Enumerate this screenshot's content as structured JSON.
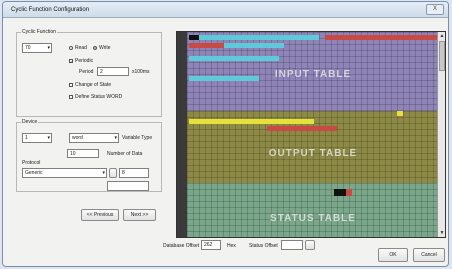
{
  "window": {
    "title": "Cyclic Function Configuration",
    "close_label": "X"
  },
  "cyclic": {
    "group_label": "Cyclic Function",
    "function_value": "70",
    "read_label": "Read",
    "write_label": "Write",
    "periodic_label": "Periodic",
    "period_label": "Period",
    "period_value": "2",
    "period_unit": "x100ms",
    "change_of_state_label": "Change of State",
    "define_status_label": "Define Status WORD"
  },
  "device": {
    "group_label": "Device",
    "device_value": "1",
    "variable_value": "word",
    "variable_type_label": "Variable Type",
    "address_value": "10",
    "number_of_data_label": "Number of Data",
    "protocol_label": "Protocol",
    "protocol_value": "Generic",
    "number_of_data_value": "8"
  },
  "nav": {
    "previous_label": "<< Previous",
    "next_label": "Next >>"
  },
  "tables": {
    "input_label": "INPUT TABLE",
    "output_label": "OUTPUT TABLE",
    "status_label": "STATUS TABLE"
  },
  "bottom": {
    "database_offset_label": "Database Offset",
    "database_offset_value": "262",
    "hex_label": "Hex",
    "status_offset_label": "Status Offset",
    "ok_label": "OK",
    "cancel_label": "Cancel"
  },
  "colors": {
    "input": "#8e84b8",
    "output": "#8d8a46",
    "status": "#7aa68a",
    "cyan": "#5ec9d8",
    "red": "#c94a44",
    "yellow": "#e6e03a",
    "black": "#111111"
  }
}
